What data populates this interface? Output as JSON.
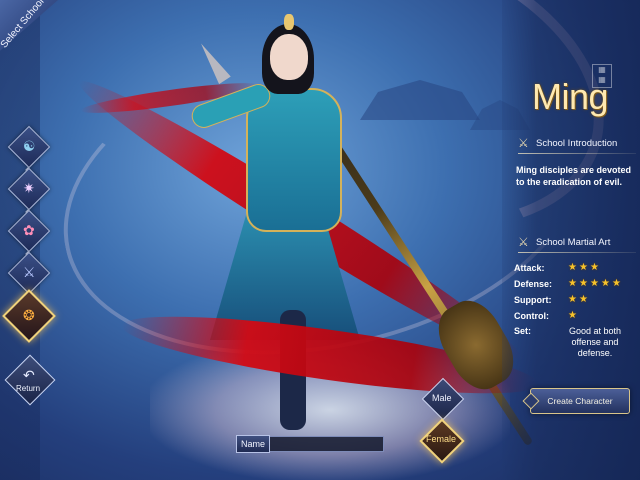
{
  "header": {
    "select_school_label": "Select School"
  },
  "schools": [
    {
      "icon": "yin-yang-icon",
      "glyph": "☯",
      "color": "#8fd0f0",
      "active": false
    },
    {
      "icon": "spider-icon",
      "glyph": "✷",
      "color": "#f0d0ff",
      "active": false
    },
    {
      "icon": "lotus-icon",
      "glyph": "✿",
      "color": "#ff8fb8",
      "active": false
    },
    {
      "icon": "blade-icon",
      "glyph": "⚔",
      "color": "#b8c8ff",
      "active": false
    },
    {
      "icon": "flame-icon",
      "glyph": "❂",
      "color": "#ffb040",
      "active": true
    }
  ],
  "return_button": {
    "label": "Return"
  },
  "school": {
    "name": "Ming",
    "introduction_title": "School Introduction",
    "introduction": "Ming disciples are devoted to the eradication of evil.",
    "martial_art_title": "School Martial Art",
    "stats": [
      {
        "label": "Attack:",
        "stars": 3,
        "max": 3
      },
      {
        "label": "Defense:",
        "stars": 5,
        "max": 5
      },
      {
        "label": "Support:",
        "stars": 2,
        "max": 2
      },
      {
        "label": "Control:",
        "stars": 1,
        "max": 1
      }
    ],
    "set_label": "Set:",
    "set_value": "Good at both offense and defense."
  },
  "create_button": {
    "label": "Create Character"
  },
  "gender": {
    "male_label": "Male",
    "female_label": "Female",
    "selected": "Female"
  },
  "name_field": {
    "label": "Name",
    "value": ""
  },
  "colors": {
    "accent_gold": "#f1d27a",
    "star": "#f6c22c",
    "title": "#ffe9b0"
  }
}
